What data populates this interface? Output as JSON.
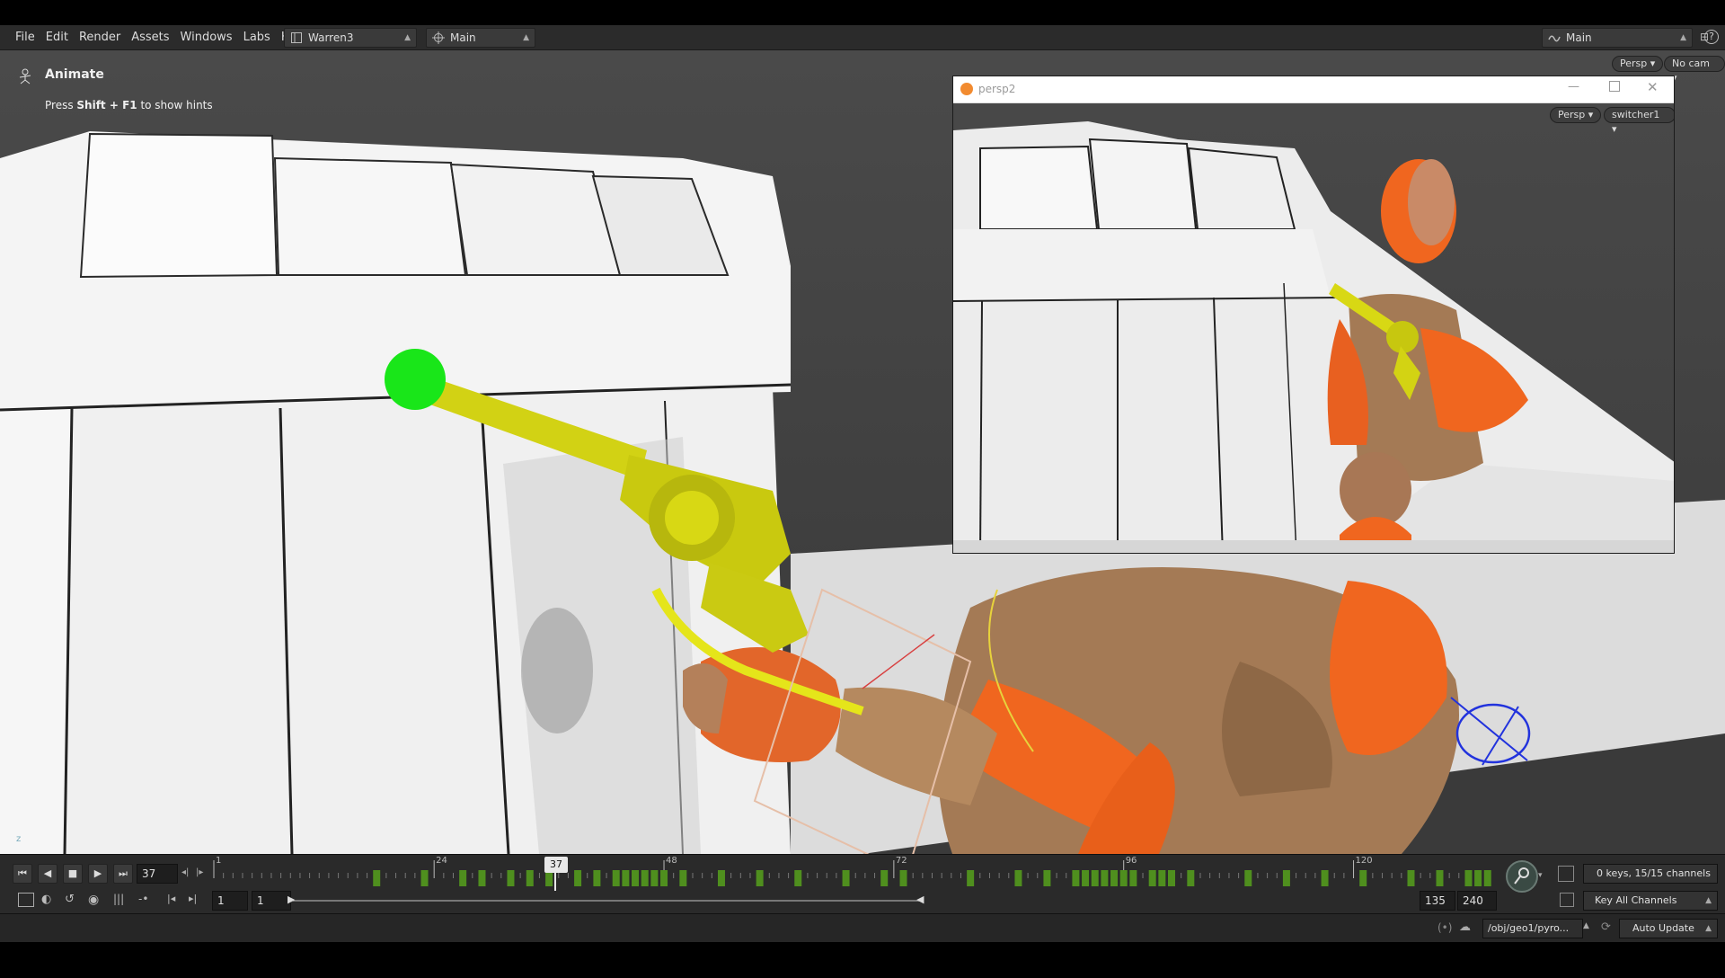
{
  "menu": {
    "items": [
      "File",
      "Edit",
      "Render",
      "Assets",
      "Windows",
      "Labs",
      "Help"
    ],
    "desktop": "Warren3",
    "network": "Main",
    "context": "Main"
  },
  "viewport": {
    "tool_name": "Animate",
    "hint_pre": "Press ",
    "hint_keys": "Shift + F1",
    "hint_post": " to show hints",
    "persp_btn": "Persp",
    "cam_btn": "No cam"
  },
  "float_window": {
    "title": "persp2",
    "persp_btn": "Persp",
    "switcher_btn": "switcher1"
  },
  "timeline": {
    "current_frame": "37",
    "ruler_labels": [
      "1",
      "24",
      "48",
      "72",
      "96",
      "120"
    ],
    "range_start": "1",
    "range_start2": "1",
    "range_end": "135",
    "global_end": "240",
    "keys_info": "0 keys, 15/15 channels",
    "key_mode": "Key All Channels"
  },
  "status": {
    "node_path": "/obj/geo1/pyro...",
    "update_mode": "Auto Update"
  },
  "colors": {
    "revolver": "#d8d814",
    "armor": "#f0661f",
    "handle_green": "#19e619",
    "key_green": "#4f8f1e"
  }
}
